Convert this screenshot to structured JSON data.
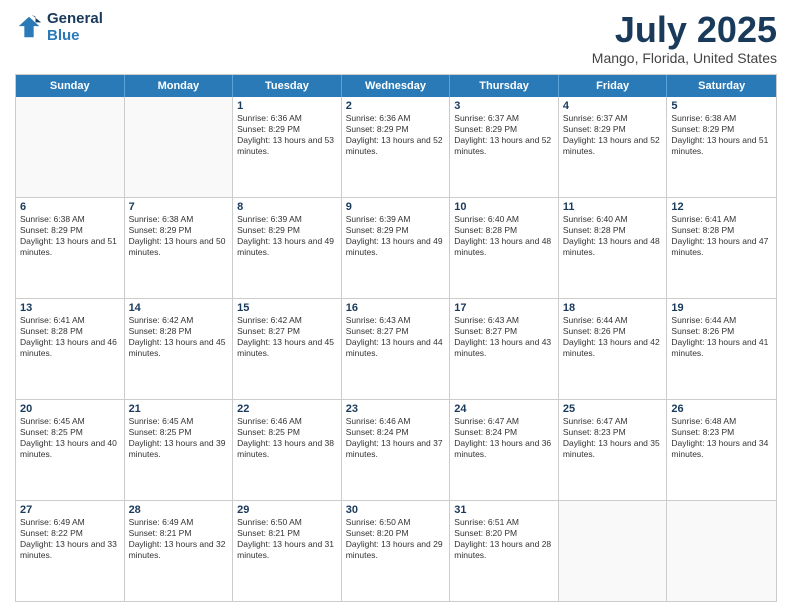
{
  "header": {
    "logo_line1": "General",
    "logo_line2": "Blue",
    "month": "July 2025",
    "location": "Mango, Florida, United States"
  },
  "weekdays": [
    "Sunday",
    "Monday",
    "Tuesday",
    "Wednesday",
    "Thursday",
    "Friday",
    "Saturday"
  ],
  "weeks": [
    [
      {
        "day": "",
        "sunrise": "",
        "sunset": "",
        "daylight": ""
      },
      {
        "day": "",
        "sunrise": "",
        "sunset": "",
        "daylight": ""
      },
      {
        "day": "1",
        "sunrise": "Sunrise: 6:36 AM",
        "sunset": "Sunset: 8:29 PM",
        "daylight": "Daylight: 13 hours and 53 minutes."
      },
      {
        "day": "2",
        "sunrise": "Sunrise: 6:36 AM",
        "sunset": "Sunset: 8:29 PM",
        "daylight": "Daylight: 13 hours and 52 minutes."
      },
      {
        "day": "3",
        "sunrise": "Sunrise: 6:37 AM",
        "sunset": "Sunset: 8:29 PM",
        "daylight": "Daylight: 13 hours and 52 minutes."
      },
      {
        "day": "4",
        "sunrise": "Sunrise: 6:37 AM",
        "sunset": "Sunset: 8:29 PM",
        "daylight": "Daylight: 13 hours and 52 minutes."
      },
      {
        "day": "5",
        "sunrise": "Sunrise: 6:38 AM",
        "sunset": "Sunset: 8:29 PM",
        "daylight": "Daylight: 13 hours and 51 minutes."
      }
    ],
    [
      {
        "day": "6",
        "sunrise": "Sunrise: 6:38 AM",
        "sunset": "Sunset: 8:29 PM",
        "daylight": "Daylight: 13 hours and 51 minutes."
      },
      {
        "day": "7",
        "sunrise": "Sunrise: 6:38 AM",
        "sunset": "Sunset: 8:29 PM",
        "daylight": "Daylight: 13 hours and 50 minutes."
      },
      {
        "day": "8",
        "sunrise": "Sunrise: 6:39 AM",
        "sunset": "Sunset: 8:29 PM",
        "daylight": "Daylight: 13 hours and 49 minutes."
      },
      {
        "day": "9",
        "sunrise": "Sunrise: 6:39 AM",
        "sunset": "Sunset: 8:29 PM",
        "daylight": "Daylight: 13 hours and 49 minutes."
      },
      {
        "day": "10",
        "sunrise": "Sunrise: 6:40 AM",
        "sunset": "Sunset: 8:28 PM",
        "daylight": "Daylight: 13 hours and 48 minutes."
      },
      {
        "day": "11",
        "sunrise": "Sunrise: 6:40 AM",
        "sunset": "Sunset: 8:28 PM",
        "daylight": "Daylight: 13 hours and 48 minutes."
      },
      {
        "day": "12",
        "sunrise": "Sunrise: 6:41 AM",
        "sunset": "Sunset: 8:28 PM",
        "daylight": "Daylight: 13 hours and 47 minutes."
      }
    ],
    [
      {
        "day": "13",
        "sunrise": "Sunrise: 6:41 AM",
        "sunset": "Sunset: 8:28 PM",
        "daylight": "Daylight: 13 hours and 46 minutes."
      },
      {
        "day": "14",
        "sunrise": "Sunrise: 6:42 AM",
        "sunset": "Sunset: 8:28 PM",
        "daylight": "Daylight: 13 hours and 45 minutes."
      },
      {
        "day": "15",
        "sunrise": "Sunrise: 6:42 AM",
        "sunset": "Sunset: 8:27 PM",
        "daylight": "Daylight: 13 hours and 45 minutes."
      },
      {
        "day": "16",
        "sunrise": "Sunrise: 6:43 AM",
        "sunset": "Sunset: 8:27 PM",
        "daylight": "Daylight: 13 hours and 44 minutes."
      },
      {
        "day": "17",
        "sunrise": "Sunrise: 6:43 AM",
        "sunset": "Sunset: 8:27 PM",
        "daylight": "Daylight: 13 hours and 43 minutes."
      },
      {
        "day": "18",
        "sunrise": "Sunrise: 6:44 AM",
        "sunset": "Sunset: 8:26 PM",
        "daylight": "Daylight: 13 hours and 42 minutes."
      },
      {
        "day": "19",
        "sunrise": "Sunrise: 6:44 AM",
        "sunset": "Sunset: 8:26 PM",
        "daylight": "Daylight: 13 hours and 41 minutes."
      }
    ],
    [
      {
        "day": "20",
        "sunrise": "Sunrise: 6:45 AM",
        "sunset": "Sunset: 8:25 PM",
        "daylight": "Daylight: 13 hours and 40 minutes."
      },
      {
        "day": "21",
        "sunrise": "Sunrise: 6:45 AM",
        "sunset": "Sunset: 8:25 PM",
        "daylight": "Daylight: 13 hours and 39 minutes."
      },
      {
        "day": "22",
        "sunrise": "Sunrise: 6:46 AM",
        "sunset": "Sunset: 8:25 PM",
        "daylight": "Daylight: 13 hours and 38 minutes."
      },
      {
        "day": "23",
        "sunrise": "Sunrise: 6:46 AM",
        "sunset": "Sunset: 8:24 PM",
        "daylight": "Daylight: 13 hours and 37 minutes."
      },
      {
        "day": "24",
        "sunrise": "Sunrise: 6:47 AM",
        "sunset": "Sunset: 8:24 PM",
        "daylight": "Daylight: 13 hours and 36 minutes."
      },
      {
        "day": "25",
        "sunrise": "Sunrise: 6:47 AM",
        "sunset": "Sunset: 8:23 PM",
        "daylight": "Daylight: 13 hours and 35 minutes."
      },
      {
        "day": "26",
        "sunrise": "Sunrise: 6:48 AM",
        "sunset": "Sunset: 8:23 PM",
        "daylight": "Daylight: 13 hours and 34 minutes."
      }
    ],
    [
      {
        "day": "27",
        "sunrise": "Sunrise: 6:49 AM",
        "sunset": "Sunset: 8:22 PM",
        "daylight": "Daylight: 13 hours and 33 minutes."
      },
      {
        "day": "28",
        "sunrise": "Sunrise: 6:49 AM",
        "sunset": "Sunset: 8:21 PM",
        "daylight": "Daylight: 13 hours and 32 minutes."
      },
      {
        "day": "29",
        "sunrise": "Sunrise: 6:50 AM",
        "sunset": "Sunset: 8:21 PM",
        "daylight": "Daylight: 13 hours and 31 minutes."
      },
      {
        "day": "30",
        "sunrise": "Sunrise: 6:50 AM",
        "sunset": "Sunset: 8:20 PM",
        "daylight": "Daylight: 13 hours and 29 minutes."
      },
      {
        "day": "31",
        "sunrise": "Sunrise: 6:51 AM",
        "sunset": "Sunset: 8:20 PM",
        "daylight": "Daylight: 13 hours and 28 minutes."
      },
      {
        "day": "",
        "sunrise": "",
        "sunset": "",
        "daylight": ""
      },
      {
        "day": "",
        "sunrise": "",
        "sunset": "",
        "daylight": ""
      }
    ]
  ]
}
